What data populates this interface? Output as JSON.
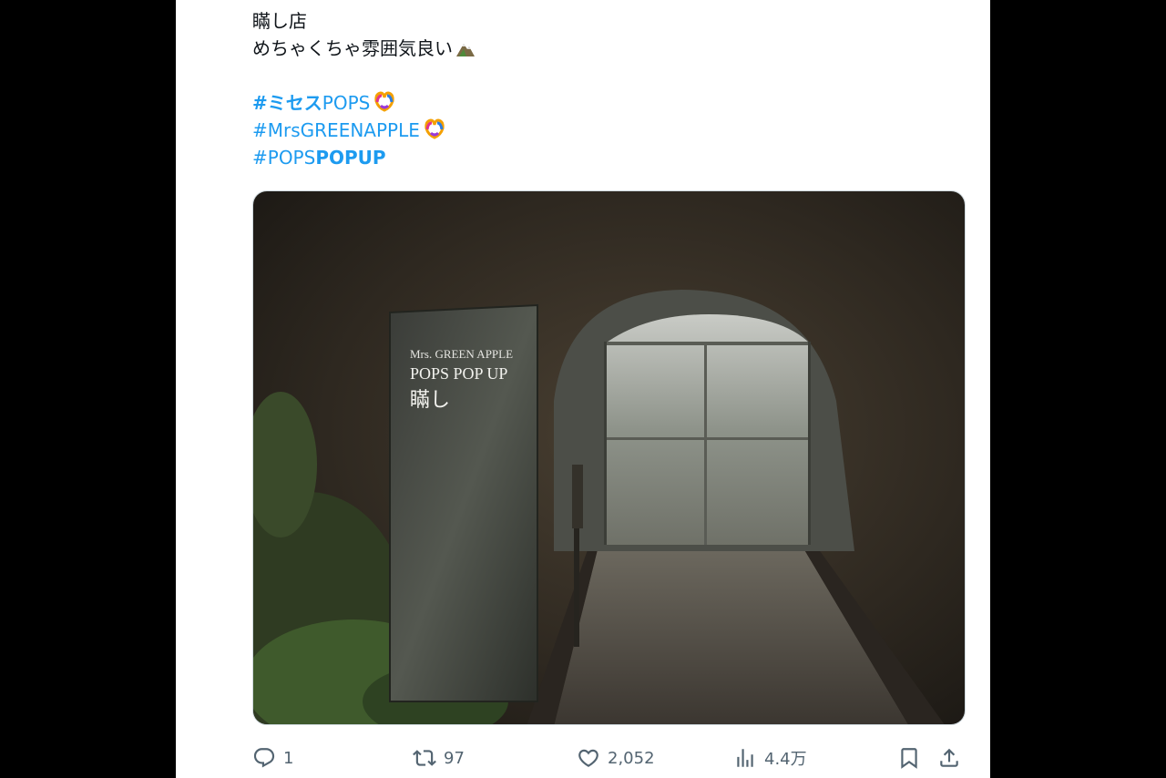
{
  "tweet": {
    "lines": [
      "瞞し店",
      "めちゃくちゃ雰囲気良い"
    ],
    "hashtags": [
      {
        "prefix": "#ミセス",
        "rest": "POPS"
      },
      {
        "prefix": "#MrsGREENAPPLE",
        "rest": ""
      },
      {
        "prefix": "#POPS",
        "rest": "POPUP"
      }
    ],
    "emoji_mountain": "mountain-emoji",
    "emoji_heart_hands": "heart-hands-emoji"
  },
  "media": {
    "sign_line1": "Mrs. GREEN APPLE",
    "sign_line2": "POPS POP UP",
    "sign_line3": "瞞し"
  },
  "actions": {
    "reply_count": "1",
    "retweet_count": "97",
    "like_count": "2,052",
    "views_count": "4.4万"
  },
  "colors": {
    "link": "#1d9bf0",
    "text": "#0f1419",
    "muted": "#536471"
  }
}
